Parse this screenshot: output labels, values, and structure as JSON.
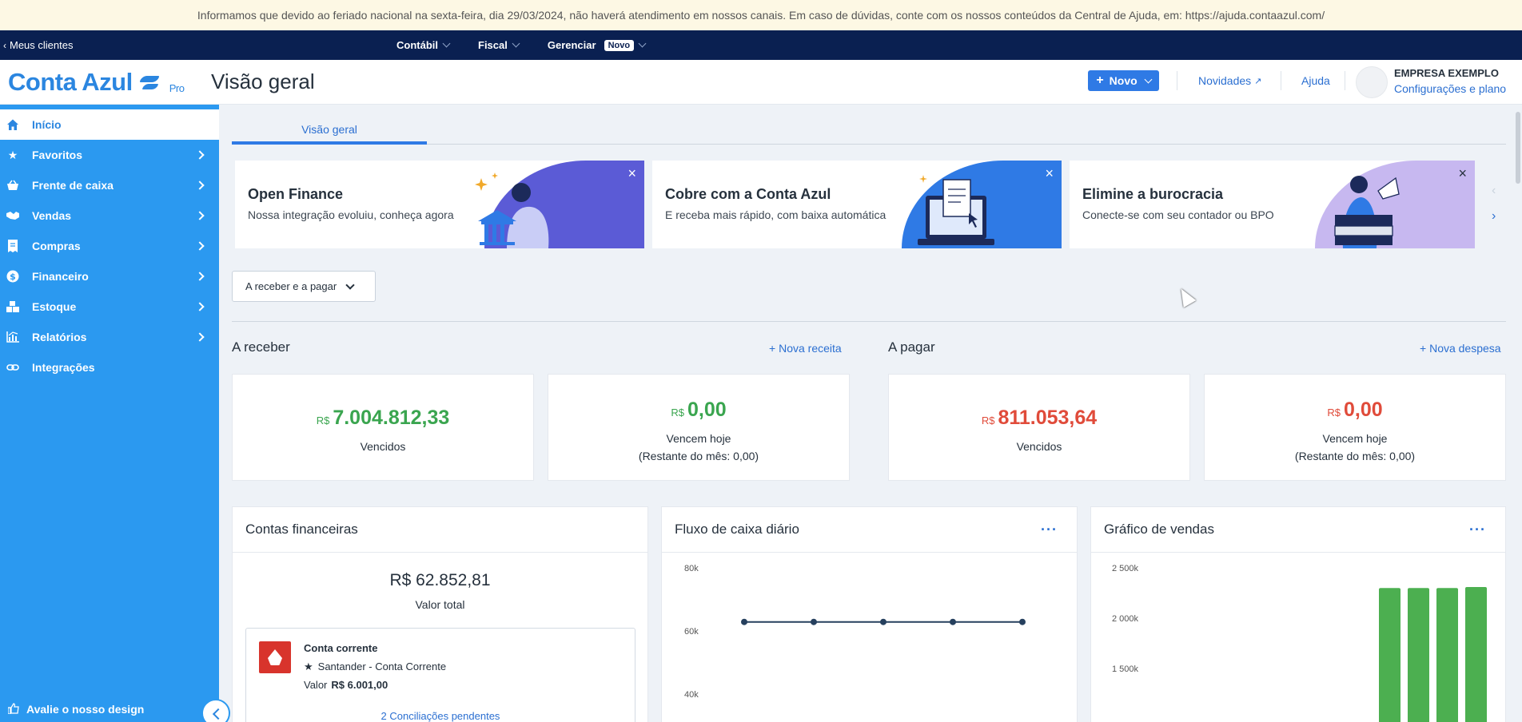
{
  "notice": "Informamos que devido ao feriado nacional na sexta-feira, dia 29/03/2024, não haverá atendimento em nossos canais. Em caso de dúvidas, conte com os nossos conteúdos da Central de Ajuda, em: https://ajuda.contaazul.com/",
  "topnav": {
    "back": "Meus clientes",
    "menu": [
      "Contábil",
      "Fiscal",
      "Gerenciar"
    ],
    "novo_badge": "Novo"
  },
  "header": {
    "logo": "Conta Azul",
    "logo_tier": "Pro",
    "title": "Visão geral",
    "new_button": "Novo",
    "news": "Novidades",
    "help": "Ajuda",
    "company": "EMPRESA EXEMPLO",
    "settings": "Configurações e plano"
  },
  "sidebar": {
    "items": [
      {
        "label": "Início",
        "icon": "home-icon"
      },
      {
        "label": "Favoritos",
        "icon": "star-icon"
      },
      {
        "label": "Frente de caixa",
        "icon": "basket-icon"
      },
      {
        "label": "Vendas",
        "icon": "handshake-icon"
      },
      {
        "label": "Compras",
        "icon": "receipt-icon"
      },
      {
        "label": "Financeiro",
        "icon": "dollar-icon"
      },
      {
        "label": "Estoque",
        "icon": "boxes-icon"
      },
      {
        "label": "Relatórios",
        "icon": "chart-icon"
      },
      {
        "label": "Integrações",
        "icon": "link-icon"
      }
    ],
    "feedback": "Avalie o nosso design"
  },
  "tabs": {
    "active": "Visão geral"
  },
  "banners": [
    {
      "title": "Open Finance",
      "subtitle": "Nossa integração evoluiu, conheça agora",
      "color": "#5b5bd6"
    },
    {
      "title": "Cobre com a Conta Azul",
      "subtitle": "E receba mais rápido, com baixa automática",
      "color": "#2f7ae5"
    },
    {
      "title": "Elimine a burocracia",
      "subtitle": "Conecte-se com seu contador ou BPO",
      "color": "#c7b8f0"
    }
  ],
  "filter_dropdown": "A receber e a pagar",
  "receivable": {
    "title": "A receber",
    "action": "Nova receita",
    "overdue": {
      "currency": "R$",
      "amount": "7.004.812,33",
      "caption": "Vencidos"
    },
    "today": {
      "currency": "R$",
      "amount": "0,00",
      "caption": "Vencem hoje",
      "note": "(Restante do mês: 0,00)"
    }
  },
  "payable": {
    "title": "A pagar",
    "action": "Nova despesa",
    "overdue": {
      "currency": "R$",
      "amount": "811.053,64",
      "caption": "Vencidos"
    },
    "today": {
      "currency": "R$",
      "amount": "0,00",
      "caption": "Vencem hoje",
      "note": "(Restante do mês: 0,00)"
    }
  },
  "accounts": {
    "title": "Contas financeiras",
    "total": "R$ 62.852,81",
    "total_label": "Valor total",
    "account": {
      "type": "Conta corrente",
      "bank": "Santander - Conta Corrente",
      "value_label": "Valor",
      "value": "R$ 6.001,00",
      "pending": "2 Conciliações pendentes"
    }
  },
  "cashflow": {
    "title": "Fluxo de caixa diário",
    "yticks": [
      "80k",
      "60k",
      "40k"
    ]
  },
  "sales": {
    "title": "Gráfico de vendas",
    "yticks": [
      "2 500k",
      "2 000k",
      "1 500k"
    ]
  },
  "chart_data": [
    {
      "type": "line",
      "title": "Fluxo de caixa diário",
      "y_ticks": [
        40000,
        60000,
        80000
      ],
      "series": [
        {
          "values": [
            62852.81,
            62852.81,
            62852.81,
            62852.81,
            62852.81
          ]
        }
      ]
    },
    {
      "type": "bar",
      "title": "Gráfico de vendas",
      "y_ticks": [
        1500000,
        2000000,
        2500000
      ],
      "series": [
        {
          "values": [
            2300000,
            2300000,
            2300000,
            2310000
          ],
          "color": "#4caf50"
        }
      ]
    }
  ]
}
